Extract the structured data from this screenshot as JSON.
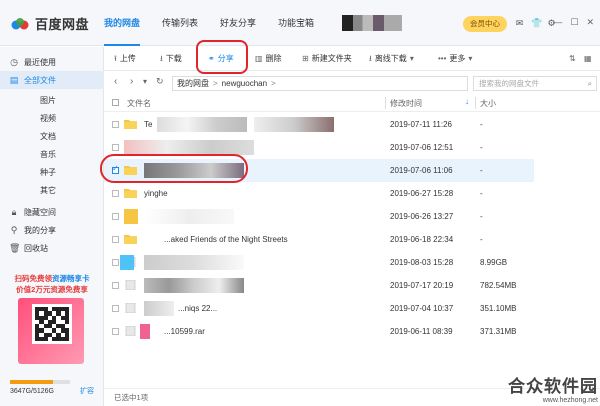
{
  "app": {
    "title": "百度网盘"
  },
  "topnav": [
    {
      "label": "我的网盘",
      "active": true
    },
    {
      "label": "传输列表"
    },
    {
      "label": "好友分享"
    },
    {
      "label": "功能宝箱"
    }
  ],
  "vip_label": "会员中心",
  "sidebar": {
    "items": [
      {
        "label": "最近使用",
        "icon": "clock-icon"
      },
      {
        "label": "全部文件",
        "icon": "file-icon",
        "active": true
      },
      {
        "label": "图片",
        "sub": true
      },
      {
        "label": "视频",
        "sub": true
      },
      {
        "label": "文档",
        "sub": true
      },
      {
        "label": "音乐",
        "sub": true
      },
      {
        "label": "种子",
        "sub": true
      },
      {
        "label": "其它",
        "sub": true
      },
      {
        "label": "隐藏空间",
        "icon": "lock-icon"
      },
      {
        "label": "我的分享",
        "icon": "share-icon"
      },
      {
        "label": "回收站",
        "icon": "trash-icon"
      }
    ],
    "promo_line1_a": "扫码免费领",
    "promo_line1_b": "资源畅享卡",
    "promo_line2": "价值2万元资源免费享",
    "usage_text": "3647G/5126G",
    "usage_fraction": 0.71,
    "expand_label": "扩容"
  },
  "toolbar": {
    "upload": "上传",
    "download": "下载",
    "share": "分享",
    "delete": "删除",
    "new_folder": "新建文件夹",
    "offline_download": "离线下载",
    "more": "更多"
  },
  "address": {
    "crumbs": [
      "我的网盘",
      "newguochan"
    ],
    "search_placeholder": "搜索我的网盘文件"
  },
  "table": {
    "headers": {
      "name": "文件名",
      "modified": "修改时间",
      "size": "大小"
    },
    "rows": [
      {
        "name": "Te",
        "date": "2019-07-11 11:26",
        "size": "-",
        "type": "folder"
      },
      {
        "name": "",
        "date": "2019-07-06 12:51",
        "size": "-",
        "type": "folder"
      },
      {
        "name": "",
        "date": "2019-07-06 11:06",
        "size": "-",
        "type": "folder",
        "selected": true
      },
      {
        "name": "yinghe",
        "date": "2019-06-27 15:28",
        "size": "-",
        "type": "folder"
      },
      {
        "name": "",
        "date": "2019-06-26 13:27",
        "size": "-",
        "type": "folder"
      },
      {
        "name": "...aked Friends of the Night Streets",
        "date": "2019-06-18 22:34",
        "size": "-",
        "type": "folder"
      },
      {
        "name": "",
        "date": "2019-08-03 15:28",
        "size": "8.99GB",
        "type": "file"
      },
      {
        "name": "",
        "date": "2019-07-17 20:19",
        "size": "782.54MB",
        "type": "file"
      },
      {
        "name": "...niqs 22...",
        "date": "2019-07-04 10:37",
        "size": "351.10MB",
        "type": "file"
      },
      {
        "name": "...10599.rar",
        "date": "2019-06-11 08:39",
        "size": "371.31MB",
        "type": "file"
      }
    ]
  },
  "status": "已选中1项",
  "watermark": {
    "big": "合众软件园",
    "url": "www.hezhong.net"
  }
}
